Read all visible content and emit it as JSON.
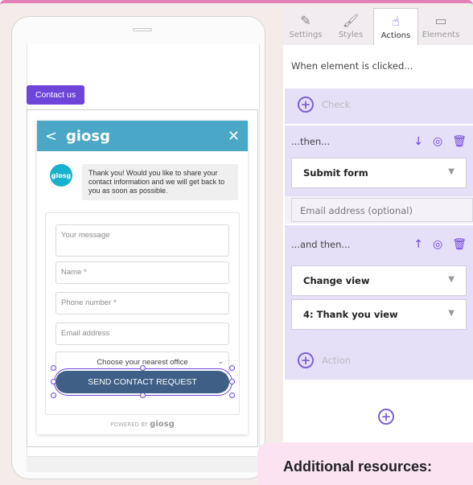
{
  "phone": {
    "contact_button": "Contact us",
    "chat": {
      "header_logo": "giosg",
      "back": "<",
      "close": "✕",
      "avatar": "giosg",
      "message": "Thank you! Would you like to share your contact information and we will get back to you as soon as possible.",
      "fields": {
        "message_placeholder": "Your message",
        "name_placeholder": "Name *",
        "phone_placeholder": "Phone number *",
        "email_placeholder": "Email address",
        "office_select": "Choose your nearest office"
      },
      "send_button": "SEND CONTACT REQUEST",
      "powered_by": "POWERED BY",
      "powered_brand": "giosg"
    }
  },
  "panel": {
    "tabs": [
      {
        "label": "Settings",
        "icon": "ruler-pencil-icon"
      },
      {
        "label": "Styles",
        "icon": "brush-icon"
      },
      {
        "label": "Actions",
        "icon": "pointer-hand-icon"
      },
      {
        "label": "Elements",
        "icon": "element-icon"
      }
    ],
    "active_tab": "Actions",
    "when_clicked": "When element is clicked...",
    "check_label": "Check",
    "then_label": "...then...",
    "submit_form": "Submit form",
    "email_optional": "Email address (optional)",
    "and_then_label": "...and then...",
    "change_view": "Change view",
    "thank_you_view": "4: Thank you view",
    "action_label": "Action"
  },
  "resources": {
    "title": "Additional resources:"
  },
  "colors": {
    "accent": "#6e44d9",
    "header": "#4aa8c6",
    "send": "#3f5f86",
    "panel_block": "#e6dff8",
    "top_border": "#e47fb8"
  }
}
